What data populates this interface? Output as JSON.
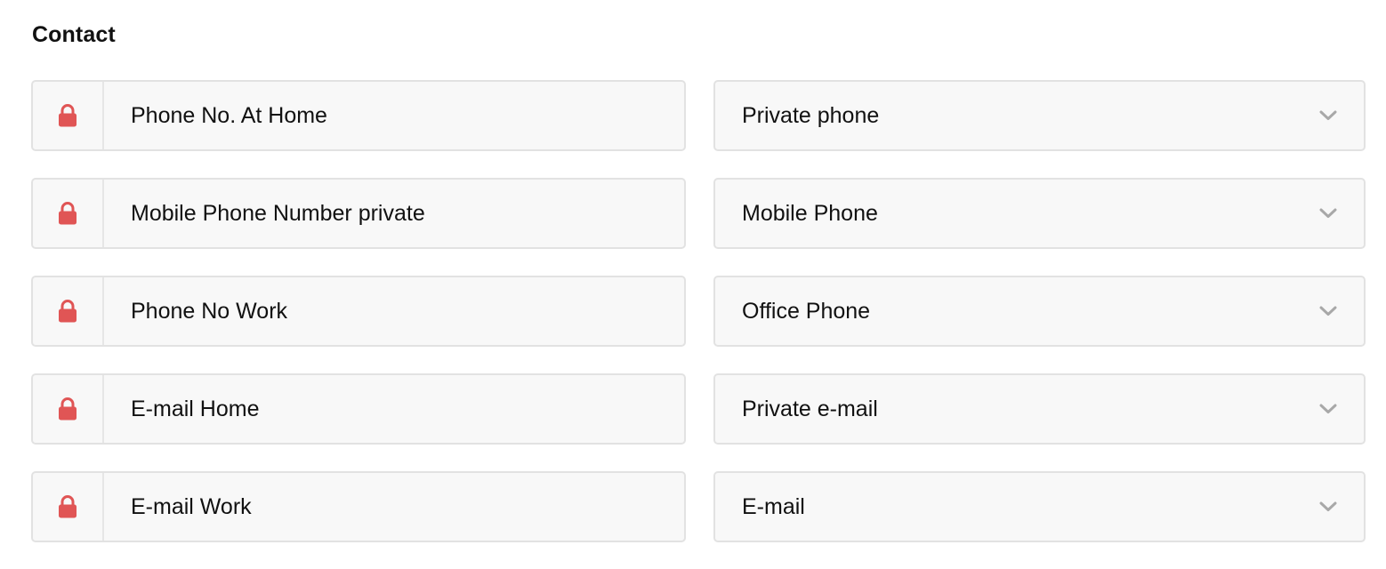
{
  "section": {
    "title": "Contact"
  },
  "icons": {
    "lock": "lock-icon",
    "chevron": "chevron-down-icon"
  },
  "colors": {
    "lock": "#e05555",
    "chevron": "#a8a8a8"
  },
  "rows": [
    {
      "field_label": "Phone No. At Home",
      "selected": "Private phone"
    },
    {
      "field_label": "Mobile Phone Number private",
      "selected": "Mobile Phone"
    },
    {
      "field_label": "Phone No Work",
      "selected": "Office Phone"
    },
    {
      "field_label": "E-mail Home",
      "selected": "Private e-mail"
    },
    {
      "field_label": "E-mail Work",
      "selected": "E-mail"
    }
  ]
}
